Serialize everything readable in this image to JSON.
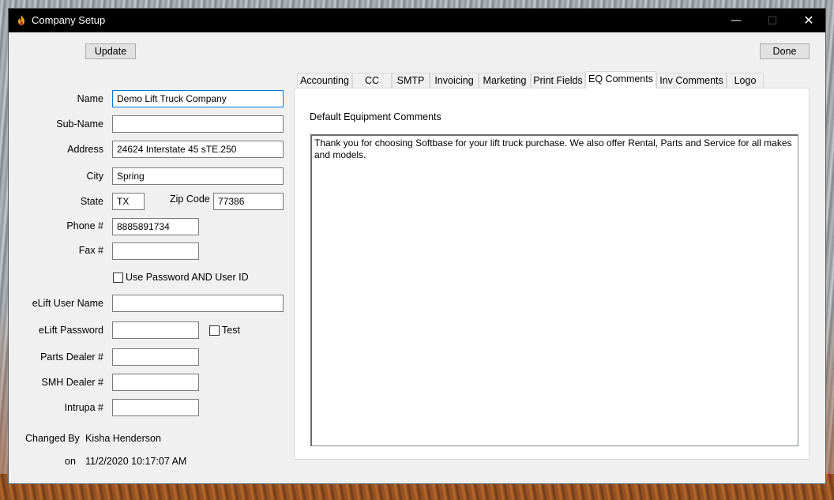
{
  "window": {
    "title": "Company Setup"
  },
  "toolbar": {
    "update_label": "Update",
    "done_label": "Done"
  },
  "form": {
    "name_label": "Name",
    "name_value": "Demo Lift Truck Company",
    "subname_label": "Sub-Name",
    "subname_value": "",
    "address_label": "Address",
    "address_value": "24624 Interstate 45 sTE.250",
    "city_label": "City",
    "city_value": "Spring",
    "state_label": "State",
    "state_value": "TX",
    "zip_label": "Zip Code",
    "zip_value": "77386",
    "phone_label": "Phone #",
    "phone_value": "8885891734",
    "fax_label": "Fax #",
    "fax_value": "",
    "use_password_label": "Use Password AND User ID",
    "use_password_checked": false,
    "elift_user_label": "eLift User Name",
    "elift_user_value": "",
    "elift_password_label": "eLift Password",
    "elift_password_value": "",
    "test_label": "Test",
    "test_checked": false,
    "parts_dealer_label": "Parts Dealer #",
    "parts_dealer_value": "",
    "smh_dealer_label": "SMH Dealer #",
    "smh_dealer_value": "",
    "intrupa_label": "Intrupa #",
    "intrupa_value": "",
    "changed_by_label": "Changed By",
    "changed_by_value": "Kisha Henderson",
    "on_label": "on",
    "on_value": "11/2/2020 10:17:07 AM"
  },
  "tabs": [
    {
      "label": "Accounting",
      "active": false
    },
    {
      "label": "CC",
      "active": false
    },
    {
      "label": "SMTP",
      "active": false
    },
    {
      "label": "Invoicing",
      "active": false
    },
    {
      "label": "Marketing",
      "active": false
    },
    {
      "label": "Print Fields",
      "active": false
    },
    {
      "label": "EQ Comments",
      "active": true
    },
    {
      "label": "Inv Comments",
      "active": false
    },
    {
      "label": "Logo",
      "active": false
    }
  ],
  "eq_comments": {
    "heading": "Default Equipment Comments",
    "text": "Thank you for choosing Softbase for your lift truck purchase.  We also offer Rental, Parts and Service for all makes and models."
  },
  "icons": {
    "app": "flame-app-icon",
    "minimize": "minimize-icon",
    "maximize": "maximize-icon",
    "close": "close-icon"
  }
}
